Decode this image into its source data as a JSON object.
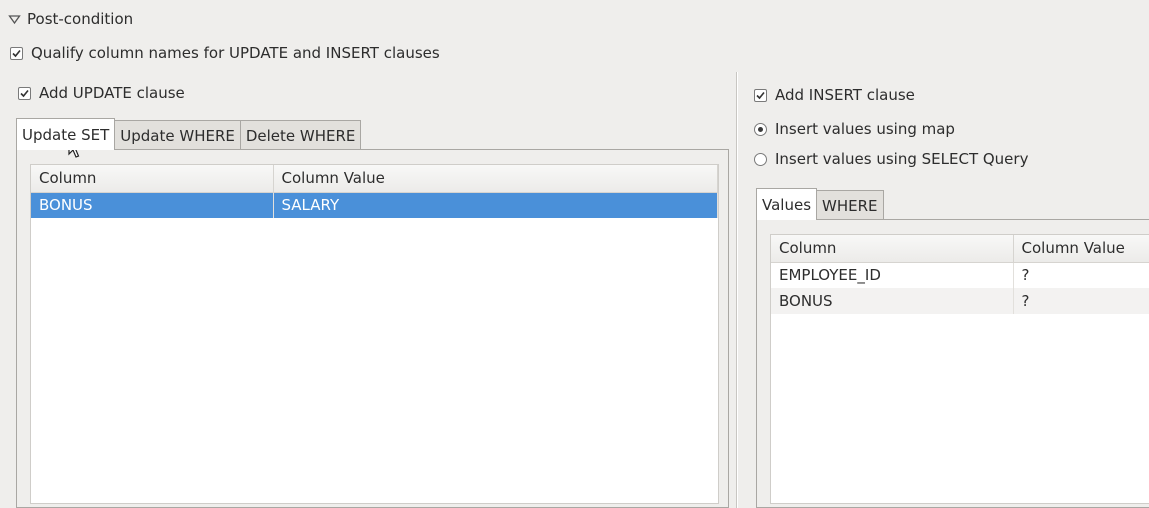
{
  "post_condition": {
    "title": "Post-condition",
    "qualify_label": "Qualify column names for UPDATE and INSERT clauses",
    "qualify_checked": true
  },
  "update": {
    "checkbox_label": "Add UPDATE clause",
    "checked": true,
    "tabs": [
      {
        "label": "Update SET",
        "active": true
      },
      {
        "label": "Update WHERE",
        "active": false
      },
      {
        "label": "Delete WHERE",
        "active": false
      }
    ],
    "table": {
      "headers": [
        "Column",
        "Column Value"
      ],
      "rows": [
        {
          "column": "BONUS",
          "value": "SALARY",
          "selected": true
        }
      ]
    }
  },
  "insert": {
    "checkbox_label": "Add INSERT clause",
    "checked": true,
    "radio_map_label": "Insert values using map",
    "radio_map_selected": true,
    "radio_select_label": "Insert values using SELECT Query",
    "radio_select_selected": false,
    "tabs": [
      {
        "label": "Values",
        "active": true
      },
      {
        "label": "WHERE",
        "active": false
      }
    ],
    "table": {
      "headers": [
        "Column",
        "Column Value"
      ],
      "rows": [
        {
          "column": "EMPLOYEE_ID",
          "value": "?"
        },
        {
          "column": "BONUS",
          "value": "?"
        }
      ]
    }
  },
  "colors": {
    "background": "#efeeec",
    "selection": "#4a90d9",
    "border": "#a9a7a3"
  }
}
